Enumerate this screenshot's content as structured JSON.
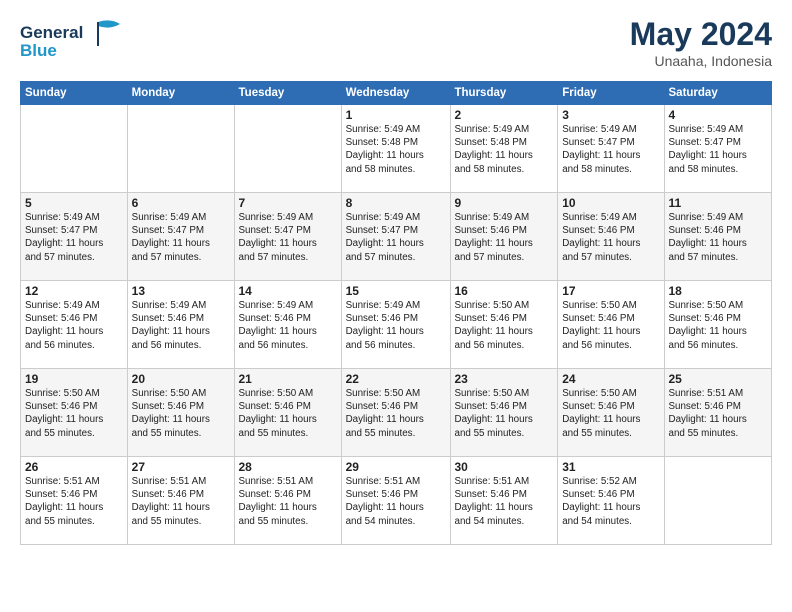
{
  "logo": {
    "line1": "General",
    "line2": "Blue"
  },
  "title": "May 2024",
  "location": "Unaaha, Indonesia",
  "weekdays": [
    "Sunday",
    "Monday",
    "Tuesday",
    "Wednesday",
    "Thursday",
    "Friday",
    "Saturday"
  ],
  "weeks": [
    [
      {
        "day": "",
        "info": ""
      },
      {
        "day": "",
        "info": ""
      },
      {
        "day": "",
        "info": ""
      },
      {
        "day": "1",
        "info": "Sunrise: 5:49 AM\nSunset: 5:48 PM\nDaylight: 11 hours\nand 58 minutes."
      },
      {
        "day": "2",
        "info": "Sunrise: 5:49 AM\nSunset: 5:48 PM\nDaylight: 11 hours\nand 58 minutes."
      },
      {
        "day": "3",
        "info": "Sunrise: 5:49 AM\nSunset: 5:47 PM\nDaylight: 11 hours\nand 58 minutes."
      },
      {
        "day": "4",
        "info": "Sunrise: 5:49 AM\nSunset: 5:47 PM\nDaylight: 11 hours\nand 58 minutes."
      }
    ],
    [
      {
        "day": "5",
        "info": "Sunrise: 5:49 AM\nSunset: 5:47 PM\nDaylight: 11 hours\nand 57 minutes."
      },
      {
        "day": "6",
        "info": "Sunrise: 5:49 AM\nSunset: 5:47 PM\nDaylight: 11 hours\nand 57 minutes."
      },
      {
        "day": "7",
        "info": "Sunrise: 5:49 AM\nSunset: 5:47 PM\nDaylight: 11 hours\nand 57 minutes."
      },
      {
        "day": "8",
        "info": "Sunrise: 5:49 AM\nSunset: 5:47 PM\nDaylight: 11 hours\nand 57 minutes."
      },
      {
        "day": "9",
        "info": "Sunrise: 5:49 AM\nSunset: 5:46 PM\nDaylight: 11 hours\nand 57 minutes."
      },
      {
        "day": "10",
        "info": "Sunrise: 5:49 AM\nSunset: 5:46 PM\nDaylight: 11 hours\nand 57 minutes."
      },
      {
        "day": "11",
        "info": "Sunrise: 5:49 AM\nSunset: 5:46 PM\nDaylight: 11 hours\nand 57 minutes."
      }
    ],
    [
      {
        "day": "12",
        "info": "Sunrise: 5:49 AM\nSunset: 5:46 PM\nDaylight: 11 hours\nand 56 minutes."
      },
      {
        "day": "13",
        "info": "Sunrise: 5:49 AM\nSunset: 5:46 PM\nDaylight: 11 hours\nand 56 minutes."
      },
      {
        "day": "14",
        "info": "Sunrise: 5:49 AM\nSunset: 5:46 PM\nDaylight: 11 hours\nand 56 minutes."
      },
      {
        "day": "15",
        "info": "Sunrise: 5:49 AM\nSunset: 5:46 PM\nDaylight: 11 hours\nand 56 minutes."
      },
      {
        "day": "16",
        "info": "Sunrise: 5:50 AM\nSunset: 5:46 PM\nDaylight: 11 hours\nand 56 minutes."
      },
      {
        "day": "17",
        "info": "Sunrise: 5:50 AM\nSunset: 5:46 PM\nDaylight: 11 hours\nand 56 minutes."
      },
      {
        "day": "18",
        "info": "Sunrise: 5:50 AM\nSunset: 5:46 PM\nDaylight: 11 hours\nand 56 minutes."
      }
    ],
    [
      {
        "day": "19",
        "info": "Sunrise: 5:50 AM\nSunset: 5:46 PM\nDaylight: 11 hours\nand 55 minutes."
      },
      {
        "day": "20",
        "info": "Sunrise: 5:50 AM\nSunset: 5:46 PM\nDaylight: 11 hours\nand 55 minutes."
      },
      {
        "day": "21",
        "info": "Sunrise: 5:50 AM\nSunset: 5:46 PM\nDaylight: 11 hours\nand 55 minutes."
      },
      {
        "day": "22",
        "info": "Sunrise: 5:50 AM\nSunset: 5:46 PM\nDaylight: 11 hours\nand 55 minutes."
      },
      {
        "day": "23",
        "info": "Sunrise: 5:50 AM\nSunset: 5:46 PM\nDaylight: 11 hours\nand 55 minutes."
      },
      {
        "day": "24",
        "info": "Sunrise: 5:50 AM\nSunset: 5:46 PM\nDaylight: 11 hours\nand 55 minutes."
      },
      {
        "day": "25",
        "info": "Sunrise: 5:51 AM\nSunset: 5:46 PM\nDaylight: 11 hours\nand 55 minutes."
      }
    ],
    [
      {
        "day": "26",
        "info": "Sunrise: 5:51 AM\nSunset: 5:46 PM\nDaylight: 11 hours\nand 55 minutes."
      },
      {
        "day": "27",
        "info": "Sunrise: 5:51 AM\nSunset: 5:46 PM\nDaylight: 11 hours\nand 55 minutes."
      },
      {
        "day": "28",
        "info": "Sunrise: 5:51 AM\nSunset: 5:46 PM\nDaylight: 11 hours\nand 55 minutes."
      },
      {
        "day": "29",
        "info": "Sunrise: 5:51 AM\nSunset: 5:46 PM\nDaylight: 11 hours\nand 54 minutes."
      },
      {
        "day": "30",
        "info": "Sunrise: 5:51 AM\nSunset: 5:46 PM\nDaylight: 11 hours\nand 54 minutes."
      },
      {
        "day": "31",
        "info": "Sunrise: 5:52 AM\nSunset: 5:46 PM\nDaylight: 11 hours\nand 54 minutes."
      },
      {
        "day": "",
        "info": ""
      }
    ]
  ]
}
